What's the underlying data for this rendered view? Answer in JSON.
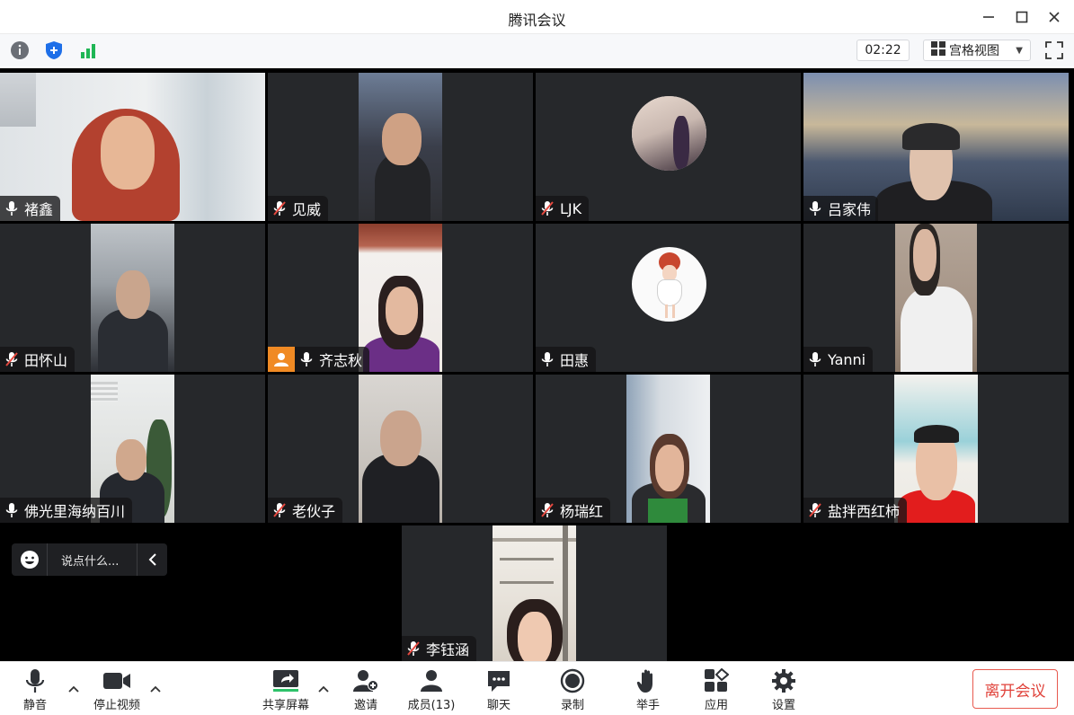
{
  "window": {
    "title": "腾讯会议"
  },
  "infobar": {
    "timer": "02:22",
    "view_mode": "宫格视图"
  },
  "participants": [
    {
      "name": "褚鑫",
      "muted": false
    },
    {
      "name": "见威",
      "muted": true
    },
    {
      "name": "LJK",
      "muted": true
    },
    {
      "name": "吕家伟",
      "muted": false
    },
    {
      "name": "田怀山",
      "muted": true
    },
    {
      "name": "齐志秋",
      "muted": false
    },
    {
      "name": "田惠",
      "muted": false
    },
    {
      "name": "Yanni",
      "muted": false
    },
    {
      "name": "佛光里海纳百川",
      "muted": false
    },
    {
      "name": "老伙子",
      "muted": true
    },
    {
      "name": "杨瑞红",
      "muted": true
    },
    {
      "name": "盐拌西红柿",
      "muted": true
    },
    {
      "name": "李钰涵",
      "muted": true
    }
  ],
  "chat": {
    "placeholder": "说点什么..."
  },
  "toolbar": {
    "mute": "静音",
    "stop_video": "停止视频",
    "share_screen": "共享屏幕",
    "invite": "邀请",
    "members": "成员(13)",
    "chat": "聊天",
    "record": "录制",
    "raise_hand": "举手",
    "apps": "应用",
    "settings": "设置",
    "leave": "离开会议"
  },
  "colors": {
    "accent_green": "#2ec26a",
    "leave_red": "#e0423a",
    "tile_bg": "#26282b",
    "avatar_orange": "#f08a24"
  }
}
